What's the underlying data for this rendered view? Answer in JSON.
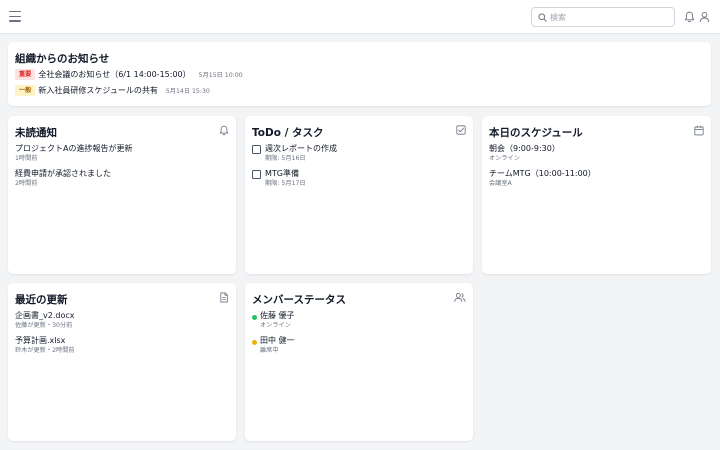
{
  "header": {
    "search_placeholder": "検索",
    "icons": [
      "menu-icon",
      "search-icon",
      "bell-icon",
      "user-icon"
    ]
  },
  "announcements": {
    "title": "組織からのお知らせ",
    "items": [
      {
        "tag": "重要",
        "tag_color": "#dc2626",
        "tag_bg": "#fee2e2",
        "text": "全社会議のお知らせ（6/1 14:00-15:00）",
        "date": "5月15日 10:00"
      },
      {
        "tag": "一般",
        "tag_color": "#a16207",
        "tag_bg": "#fef3c7",
        "text": "新入社員研修スケジュールの共有",
        "date": "5月14日 15:30"
      }
    ]
  },
  "notifications": {
    "title": "未読通知",
    "icon": "bell-icon",
    "items": [
      {
        "title": "プロジェクトAの進捗報告が更新",
        "sub": "1時間前"
      },
      {
        "title": "経費申請が承認されました",
        "sub": "2時間前"
      }
    ]
  },
  "todo": {
    "title": "ToDo / タスク",
    "icon": "checkbox-icon",
    "items": [
      {
        "title": "週次レポートの作成",
        "sub": "期限: 5月16日"
      },
      {
        "title": "MTG準備",
        "sub": "期限: 5月17日"
      }
    ]
  },
  "schedule": {
    "title": "本日のスケジュール",
    "icon": "calendar-icon",
    "items": [
      {
        "title": "朝会（9:00-9:30）",
        "sub": "オンライン"
      },
      {
        "title": "チームMTG（10:00-11:00）",
        "sub": "会議室A"
      }
    ]
  },
  "updates": {
    "title": "最近の更新",
    "icon": "document-icon",
    "items": [
      {
        "title": "企画書_v2.docx",
        "sub": "佐藤が更新・30分前"
      },
      {
        "title": "予算計画.xlsx",
        "sub": "鈴木が更新・2時間前"
      }
    ]
  },
  "members": {
    "title": "メンバーステータス",
    "icon": "users-icon",
    "items": [
      {
        "name": "佐藤 優子",
        "status": "オンライン",
        "color": "#22c55e"
      },
      {
        "name": "田中 健一",
        "status": "離席中",
        "color": "#eab308"
      }
    ]
  }
}
